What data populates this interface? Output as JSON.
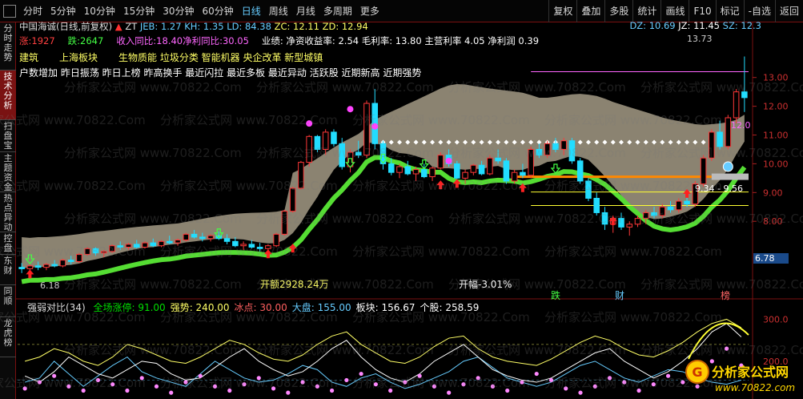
{
  "toolbar": {
    "periods": [
      "分时",
      "5分钟",
      "10分钟",
      "15分钟",
      "30分钟",
      "60分钟",
      "日线",
      "周线",
      "月线",
      "多周期",
      "更多"
    ],
    "active_period": "日线",
    "right_buttons": [
      "复权",
      "叠加",
      "多股",
      "统计",
      "画线",
      "F10",
      "标记",
      "-自选",
      "返回"
    ]
  },
  "sidebar": {
    "tabs": [
      "分时走势",
      "技术分析",
      "扫盘宝",
      "主题资金",
      "热点异动",
      "控盘",
      "东财",
      "同顺",
      "龙虎榜"
    ],
    "active": "技术分析"
  },
  "stock": {
    "name": "中国海诚(日线,前复权)",
    "zt": "ZT",
    "indicators": [
      {
        "label": "JEB: 1.27",
        "color": "#66ccff"
      },
      {
        "label": "KH: 1.35",
        "color": "#66ccff"
      },
      {
        "label": "LD: 84.38",
        "color": "#66ccff"
      },
      {
        "label": "ZC: 12.11",
        "color": "#ffff66"
      },
      {
        "label": "ZD: 12.94",
        "color": "#ffff66"
      }
    ],
    "right_indicators": [
      {
        "label": "DZ: 10.69",
        "color": "#66ccff"
      },
      {
        "label": "JZ: 11.45",
        "color": "#ffffff"
      },
      {
        "label": "SZ: 12.3",
        "color": "#66ccff"
      }
    ],
    "line2_parts": [
      {
        "t": "涨:1927",
        "c": "#ff4040"
      },
      {
        "t": "跌:2647",
        "c": "#44ff44"
      },
      {
        "t": "收入同比:18.40净利同比:30.05",
        "c": "#ff66ff"
      },
      {
        "t": "业绩: 净资收益率: 2.54 毛利率: 13.80 主营利率 4.05 净利润 0.39",
        "c": "#ffffff"
      }
    ],
    "concepts": [
      {
        "t": "建筑",
        "c": "#ffff66"
      },
      {
        "t": "上海板块",
        "c": "#ffff66"
      },
      {
        "t": "生物质能 垃圾分类 智能机器 央企改革 新型城镇",
        "c": "#ffff66"
      }
    ],
    "tags_line": "户数增加 昨日振荡 昨日上榜 昨高换手 最近闪拉 最近多板 最近异动 活跃股 近期新高 近期强势"
  },
  "annotations": {
    "high_label": "13.73",
    "low_label": "6.18",
    "amount_label": "开额2928.24万",
    "open_pct_label": "开幅-3.01%",
    "range_label": "9.34 - 9.56",
    "level_label": "12.0",
    "current_price_badge": "6.78",
    "markers": [
      {
        "t": "跌",
        "c": "#44ff44"
      },
      {
        "t": "财",
        "c": "#66ccff"
      },
      {
        "t": "榜",
        "c": "#ff6666"
      }
    ]
  },
  "chart_data": [
    {
      "type": "candlestick",
      "title": "中国海诚(日线,前复权)",
      "ylim": [
        6.0,
        13.8
      ],
      "yticks": [
        8.0,
        9.0,
        10.0,
        11.0,
        12.0,
        13.0
      ],
      "ohlc": [
        [
          6.4,
          6.55,
          6.2,
          6.35
        ],
        [
          6.35,
          6.5,
          6.25,
          6.45
        ],
        [
          6.45,
          6.6,
          6.3,
          6.4
        ],
        [
          6.4,
          6.55,
          6.3,
          6.5
        ],
        [
          6.5,
          6.65,
          6.4,
          6.45
        ],
        [
          6.45,
          6.7,
          6.4,
          6.65
        ],
        [
          6.65,
          6.8,
          6.5,
          6.6
        ],
        [
          6.6,
          6.9,
          6.55,
          6.85
        ],
        [
          6.85,
          7.1,
          6.8,
          7.05
        ],
        [
          7.05,
          7.1,
          6.8,
          6.9
        ],
        [
          6.9,
          7.0,
          6.75,
          6.95
        ],
        [
          6.95,
          7.2,
          6.9,
          7.15
        ],
        [
          7.15,
          7.3,
          7.0,
          7.1
        ],
        [
          7.1,
          7.25,
          7.0,
          7.2
        ],
        [
          7.2,
          7.35,
          7.05,
          7.1
        ],
        [
          7.1,
          7.3,
          7.05,
          7.25
        ],
        [
          7.25,
          7.4,
          7.1,
          7.15
        ],
        [
          7.15,
          7.35,
          7.1,
          7.3
        ],
        [
          7.3,
          7.5,
          7.2,
          7.25
        ],
        [
          7.25,
          7.4,
          7.15,
          7.35
        ],
        [
          7.35,
          7.6,
          7.3,
          7.55
        ],
        [
          7.55,
          7.7,
          7.4,
          7.45
        ],
        [
          7.45,
          7.6,
          7.3,
          7.4
        ],
        [
          7.4,
          7.55,
          7.3,
          7.5
        ],
        [
          7.5,
          7.65,
          7.35,
          7.4
        ],
        [
          7.4,
          7.55,
          7.2,
          7.3
        ],
        [
          7.3,
          7.45,
          7.1,
          7.15
        ],
        [
          7.15,
          7.3,
          7.0,
          7.2
        ],
        [
          7.2,
          7.35,
          7.05,
          7.1
        ],
        [
          7.1,
          7.25,
          6.95,
          7.05
        ],
        [
          7.05,
          7.2,
          6.9,
          7.15
        ],
        [
          7.15,
          7.6,
          7.1,
          7.55
        ],
        [
          7.55,
          8.4,
          7.5,
          8.35
        ],
        [
          8.35,
          9.2,
          8.3,
          9.15
        ],
        [
          9.15,
          10.1,
          9.1,
          10.05
        ],
        [
          10.05,
          11.0,
          9.9,
          10.95
        ],
        [
          10.95,
          11.0,
          10.4,
          10.5
        ],
        [
          10.5,
          11.2,
          10.3,
          11.1
        ],
        [
          11.1,
          11.2,
          10.6,
          10.7
        ],
        [
          10.7,
          10.9,
          9.8,
          9.9
        ],
        [
          9.9,
          10.5,
          9.7,
          10.4
        ],
        [
          10.4,
          10.8,
          10.2,
          10.3
        ],
        [
          10.3,
          12.2,
          10.2,
          12.1
        ],
        [
          12.1,
          12.6,
          10.5,
          10.7
        ],
        [
          10.7,
          10.8,
          9.8,
          10.0
        ],
        [
          10.0,
          10.2,
          9.6,
          9.7
        ],
        [
          9.7,
          10.0,
          9.5,
          9.9
        ],
        [
          9.9,
          10.1,
          9.6,
          9.65
        ],
        [
          9.65,
          9.9,
          9.4,
          9.8
        ],
        [
          9.8,
          10.0,
          9.5,
          9.55
        ],
        [
          9.55,
          9.9,
          9.4,
          9.85
        ],
        [
          9.85,
          10.4,
          9.8,
          10.3
        ],
        [
          10.3,
          10.5,
          9.9,
          10.0
        ],
        [
          10.0,
          10.1,
          9.4,
          9.5
        ],
        [
          9.5,
          9.8,
          9.3,
          9.7
        ],
        [
          9.7,
          10.0,
          9.6,
          9.95
        ],
        [
          9.95,
          10.1,
          9.6,
          9.65
        ],
        [
          9.65,
          10.3,
          9.6,
          10.2
        ],
        [
          10.2,
          10.5,
          10.0,
          10.1
        ],
        [
          10.1,
          10.2,
          9.3,
          9.4
        ],
        [
          9.4,
          9.8,
          9.3,
          9.7
        ],
        [
          9.7,
          10.0,
          9.5,
          9.6
        ],
        [
          9.6,
          10.6,
          9.5,
          10.5
        ],
        [
          10.5,
          10.7,
          10.2,
          10.3
        ],
        [
          10.3,
          10.8,
          10.2,
          10.7
        ],
        [
          10.7,
          10.9,
          10.4,
          10.5
        ],
        [
          10.5,
          10.9,
          10.3,
          10.8
        ],
        [
          10.8,
          10.9,
          10.0,
          10.1
        ],
        [
          10.1,
          10.2,
          9.3,
          9.4
        ],
        [
          9.4,
          9.5,
          8.7,
          8.8
        ],
        [
          8.8,
          9.0,
          8.2,
          8.3
        ],
        [
          8.3,
          8.5,
          7.7,
          7.9
        ],
        [
          7.9,
          8.2,
          7.6,
          8.1
        ],
        [
          8.1,
          8.3,
          7.7,
          7.8
        ],
        [
          7.8,
          8.0,
          7.5,
          7.9
        ],
        [
          7.9,
          8.2,
          7.8,
          8.1
        ],
        [
          8.1,
          8.4,
          7.9,
          8.3
        ],
        [
          8.3,
          8.5,
          8.1,
          8.2
        ],
        [
          8.2,
          8.6,
          8.1,
          8.5
        ],
        [
          8.5,
          8.7,
          8.3,
          8.4
        ],
        [
          8.4,
          8.8,
          8.3,
          8.7
        ],
        [
          8.7,
          9.0,
          8.5,
          8.6
        ],
        [
          8.6,
          9.4,
          8.5,
          9.3
        ],
        [
          9.3,
          10.3,
          9.2,
          10.2
        ],
        [
          10.2,
          11.2,
          10.1,
          11.1
        ],
        [
          11.1,
          11.5,
          10.5,
          10.6
        ],
        [
          10.6,
          11.7,
          10.5,
          11.6
        ],
        [
          11.6,
          12.6,
          11.4,
          12.5
        ],
        [
          12.5,
          13.73,
          11.8,
          12.3
        ]
      ],
      "series": [
        {
          "name": "JZ",
          "color": "#ffffff",
          "values": [
            12.3
          ]
        },
        {
          "name": "ZC",
          "color": "#ffff66",
          "values": [
            12.11
          ]
        },
        {
          "name": "ZD",
          "color": "#ffff66",
          "values": [
            12.94
          ]
        }
      ]
    },
    {
      "type": "line",
      "title": "强弱对比(34)",
      "legend": [
        {
          "name": "全场涨停",
          "value": "91.00",
          "color": "#00dd00"
        },
        {
          "name": "强势",
          "value": "240.00",
          "color": "#ffff66"
        },
        {
          "name": "冰点",
          "value": "30.00",
          "color": "#ff6060"
        },
        {
          "name": "大盘",
          "value": "155.00",
          "color": "#66ccff"
        },
        {
          "name": "板块",
          "value": "156.67",
          "color": "#ffffff"
        },
        {
          "name": "个股",
          "value": "258.59",
          "color": "#ffffff"
        }
      ],
      "ylim": [
        110,
        320
      ],
      "yticks": [
        200.0,
        300.0
      ],
      "series": [
        {
          "name": "大盘",
          "color": "#66ccff",
          "values": [
            150,
            160,
            200,
            170,
            140,
            165,
            190,
            210,
            175,
            160,
            150,
            140,
            170,
            200,
            180,
            160,
            150,
            155,
            170,
            190,
            180,
            150,
            140,
            160,
            170,
            150,
            135,
            145,
            160,
            175,
            200,
            210,
            185,
            160,
            150,
            140,
            150,
            170,
            190,
            200,
            180,
            160,
            150,
            165,
            180,
            175,
            160,
            150,
            145,
            155
          ]
        },
        {
          "name": "板块",
          "color": "#ffffff",
          "values": [
            165,
            150,
            175,
            210,
            190,
            170,
            160,
            180,
            200,
            195,
            170,
            155,
            160,
            185,
            210,
            230,
            200,
            180,
            165,
            175,
            200,
            230,
            250,
            210,
            180,
            160,
            150,
            170,
            200,
            220,
            240,
            210,
            180,
            165,
            155,
            150,
            160,
            180,
            200,
            220,
            230,
            200,
            180,
            160,
            175,
            200,
            230,
            270,
            290,
            258
          ]
        },
        {
          "name": "个股",
          "color": "#ffff66",
          "values": [
            200,
            210,
            230,
            220,
            200,
            190,
            210,
            240,
            230,
            215,
            200,
            195,
            210,
            230,
            250,
            240,
            220,
            205,
            200,
            215,
            240,
            260,
            270,
            240,
            220,
            200,
            195,
            210,
            235,
            255,
            260,
            230,
            210,
            200,
            195,
            190,
            205,
            225,
            245,
            260,
            250,
            230,
            215,
            210,
            225,
            245,
            270,
            290,
            300,
            280
          ]
        },
        {
          "name": "个股点",
          "color": "#ff88ff",
          "values": [
            135,
            150,
            165,
            140,
            130,
            155,
            145,
            130,
            160,
            140,
            125,
            150,
            165,
            140,
            130,
            145,
            160,
            135,
            125,
            150,
            140,
            130,
            155,
            170,
            145,
            130,
            150,
            165,
            140,
            125,
            145,
            160,
            140,
            130,
            150,
            170,
            155,
            135,
            125,
            140,
            160,
            150,
            130,
            145,
            165,
            150,
            140,
            200,
            230,
            190
          ]
        }
      ]
    }
  ]
}
